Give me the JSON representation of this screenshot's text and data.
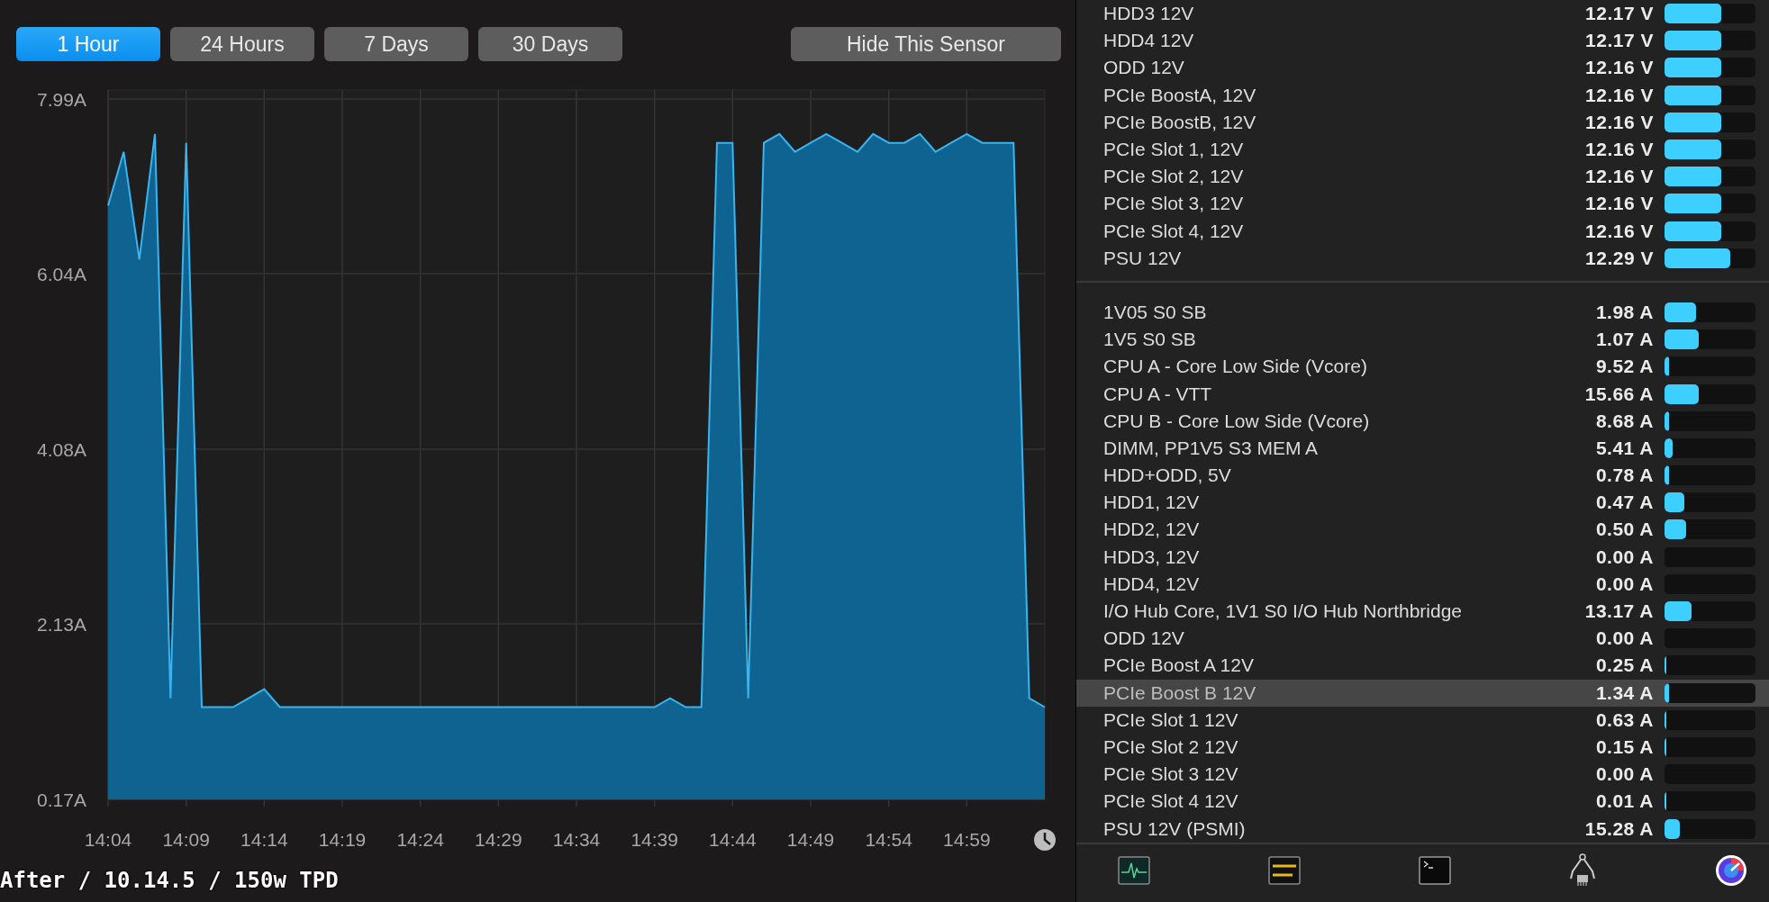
{
  "range_buttons": [
    {
      "label": "1 Hour",
      "selected": true
    },
    {
      "label": "24 Hours",
      "selected": false
    },
    {
      "label": "7 Days",
      "selected": false
    },
    {
      "label": "30 Days",
      "selected": false
    }
  ],
  "hide_button": {
    "label": "Hide This Sensor"
  },
  "chart": {
    "chart_data": {
      "type": "area",
      "grid": true,
      "ylim": [
        0.17,
        7.99
      ],
      "categories": [
        "14:04",
        null,
        null,
        null,
        null,
        "14:09",
        null,
        null,
        null,
        null,
        "14:14",
        null,
        null,
        null,
        null,
        "14:19",
        null,
        null,
        null,
        null,
        "14:24",
        null,
        null,
        null,
        null,
        "14:29",
        null,
        null,
        null,
        null,
        "14:34",
        null,
        null,
        null,
        null,
        "14:39",
        null,
        null,
        null,
        null,
        "14:44",
        null,
        null,
        null,
        null,
        "14:49",
        null,
        null,
        null,
        null,
        "14:54",
        null,
        null,
        null,
        null,
        "14:59",
        null,
        null,
        null,
        null,
        null
      ],
      "series": [
        {
          "color": "#3ab4ee",
          "values": [
            6.8,
            7.4,
            6.2,
            7.6,
            1.3,
            7.5,
            1.2,
            1.2,
            1.2,
            1.3,
            1.4,
            1.2,
            1.2,
            1.2,
            1.2,
            1.2,
            1.2,
            1.2,
            1.2,
            1.2,
            1.2,
            1.2,
            1.2,
            1.2,
            1.2,
            1.2,
            1.2,
            1.2,
            1.2,
            1.2,
            1.2,
            1.2,
            1.2,
            1.2,
            1.2,
            1.2,
            1.3,
            1.2,
            1.2,
            7.5,
            7.5,
            1.3,
            7.5,
            7.6,
            7.4,
            7.5,
            7.6,
            7.5,
            7.4,
            7.6,
            7.5,
            7.5,
            7.6,
            7.4,
            7.5,
            7.6,
            7.5,
            7.5,
            7.5,
            1.3,
            1.2
          ]
        }
      ],
      "yticks": [
        {
          "value": 7.99,
          "label": "7.99A"
        },
        {
          "value": 6.04,
          "label": "6.04A"
        },
        {
          "value": 4.08,
          "label": "4.08A"
        },
        {
          "value": 2.13,
          "label": "2.13A"
        },
        {
          "value": 0.17,
          "label": "0.17A"
        }
      ]
    }
  },
  "caption": "After / 10.14.5 / 150w TPD",
  "sensor_groups": [
    {
      "rows": [
        {
          "name": "HDD3 12V",
          "reading": "12.17 V",
          "level": 0.62,
          "selected": false
        },
        {
          "name": "HDD4 12V",
          "reading": "12.17 V",
          "level": 0.62,
          "selected": false
        },
        {
          "name": "ODD 12V",
          "reading": "12.16 V",
          "level": 0.62,
          "selected": false
        },
        {
          "name": "PCIe BoostA, 12V",
          "reading": "12.16 V",
          "level": 0.62,
          "selected": false
        },
        {
          "name": "PCIe BoostB, 12V",
          "reading": "12.16 V",
          "level": 0.62,
          "selected": false
        },
        {
          "name": "PCIe Slot 1, 12V",
          "reading": "12.16 V",
          "level": 0.62,
          "selected": false
        },
        {
          "name": "PCIe Slot 2, 12V",
          "reading": "12.16 V",
          "level": 0.62,
          "selected": false
        },
        {
          "name": "PCIe Slot 3, 12V",
          "reading": "12.16 V",
          "level": 0.62,
          "selected": false
        },
        {
          "name": "PCIe Slot 4, 12V",
          "reading": "12.16 V",
          "level": 0.62,
          "selected": false
        },
        {
          "name": "PSU 12V",
          "reading": "12.29 V",
          "level": 0.72,
          "selected": false
        }
      ]
    },
    {
      "rows": [
        {
          "name": "1V05 S0 SB",
          "reading": "1.98 A",
          "level": 0.35,
          "selected": false
        },
        {
          "name": "1V5 S0 SB",
          "reading": "1.07 A",
          "level": 0.38,
          "selected": false
        },
        {
          "name": "CPU A - Core Low Side (Vcore)",
          "reading": "9.52 A",
          "level": 0.05,
          "selected": false
        },
        {
          "name": "CPU A - VTT",
          "reading": "15.66 A",
          "level": 0.38,
          "selected": false
        },
        {
          "name": "CPU B - Core Low Side (Vcore)",
          "reading": "8.68 A",
          "level": 0.05,
          "selected": false
        },
        {
          "name": "DIMM, PP1V5 S3 MEM A",
          "reading": "5.41 A",
          "level": 0.09,
          "selected": false
        },
        {
          "name": "HDD+ODD, 5V",
          "reading": "0.78 A",
          "level": 0.05,
          "selected": false
        },
        {
          "name": "HDD1, 12V",
          "reading": "0.47 A",
          "level": 0.22,
          "selected": false
        },
        {
          "name": "HDD2, 12V",
          "reading": "0.50 A",
          "level": 0.24,
          "selected": false
        },
        {
          "name": "HDD3, 12V",
          "reading": "0.00 A",
          "level": 0,
          "selected": false
        },
        {
          "name": "HDD4, 12V",
          "reading": "0.00 A",
          "level": 0,
          "selected": false
        },
        {
          "name": "I/O Hub Core, 1V1 S0 I/O Hub Northbridge",
          "reading": "13.17 A",
          "level": 0.3,
          "selected": false
        },
        {
          "name": "ODD 12V",
          "reading": "0.00 A",
          "level": 0,
          "selected": false
        },
        {
          "name": "PCIe Boost A 12V",
          "reading": "0.25 A",
          "level": 0.02,
          "selected": false
        },
        {
          "name": "PCIe Boost B 12V",
          "reading": "1.34 A",
          "level": 0.05,
          "selected": true
        },
        {
          "name": "PCIe Slot 1 12V",
          "reading": "0.63 A",
          "level": 0.02,
          "selected": false
        },
        {
          "name": "PCIe Slot 2 12V",
          "reading": "0.15 A",
          "level": 0.02,
          "selected": false
        },
        {
          "name": "PCIe Slot 3 12V",
          "reading": "0.00 A",
          "level": 0,
          "selected": false
        },
        {
          "name": "PCIe Slot 4 12V",
          "reading": "0.01 A",
          "level": 0.02,
          "selected": false
        },
        {
          "name": "PSU 12V (PSMI)",
          "reading": "15.28 A",
          "level": 0.17,
          "selected": false
        }
      ]
    }
  ]
}
